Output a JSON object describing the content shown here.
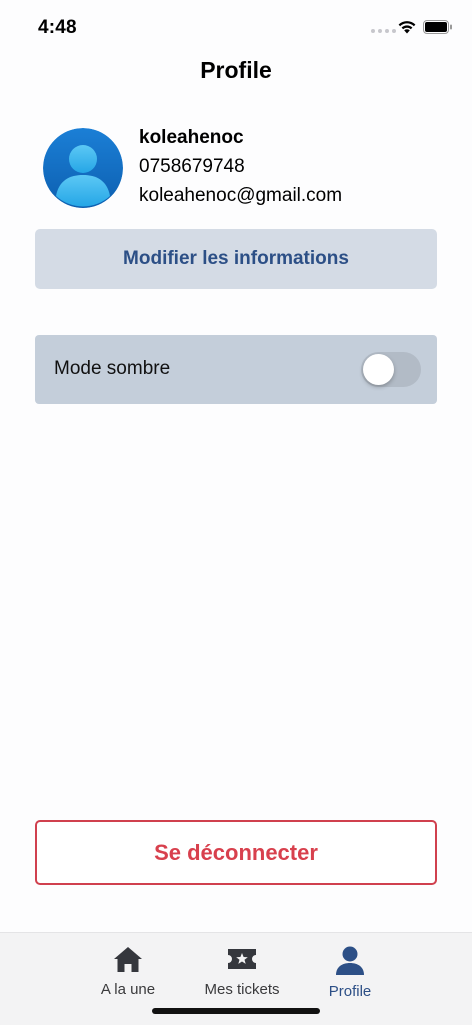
{
  "status_bar": {
    "time": "4:48"
  },
  "page": {
    "title": "Profile"
  },
  "profile": {
    "name": "koleahenoc",
    "phone": "0758679748",
    "email": "koleahenoc@gmail.com",
    "edit_button_label": "Modifier les informations"
  },
  "settings": {
    "dark_mode_label": "Mode sombre",
    "dark_mode_enabled": false
  },
  "logout_label": "Se déconnecter",
  "tab_bar": {
    "tabs": [
      {
        "label": "A la une",
        "icon": "home-icon",
        "active": false
      },
      {
        "label": "Mes tickets",
        "icon": "ticket-icon",
        "active": false
      },
      {
        "label": "Profile",
        "icon": "user-icon",
        "active": true
      }
    ]
  },
  "colors": {
    "accent": "#2c4f86",
    "danger": "#d8404d",
    "edit_button_bg": "#d4dbe5",
    "settings_row_bg": "#c4ceda"
  }
}
